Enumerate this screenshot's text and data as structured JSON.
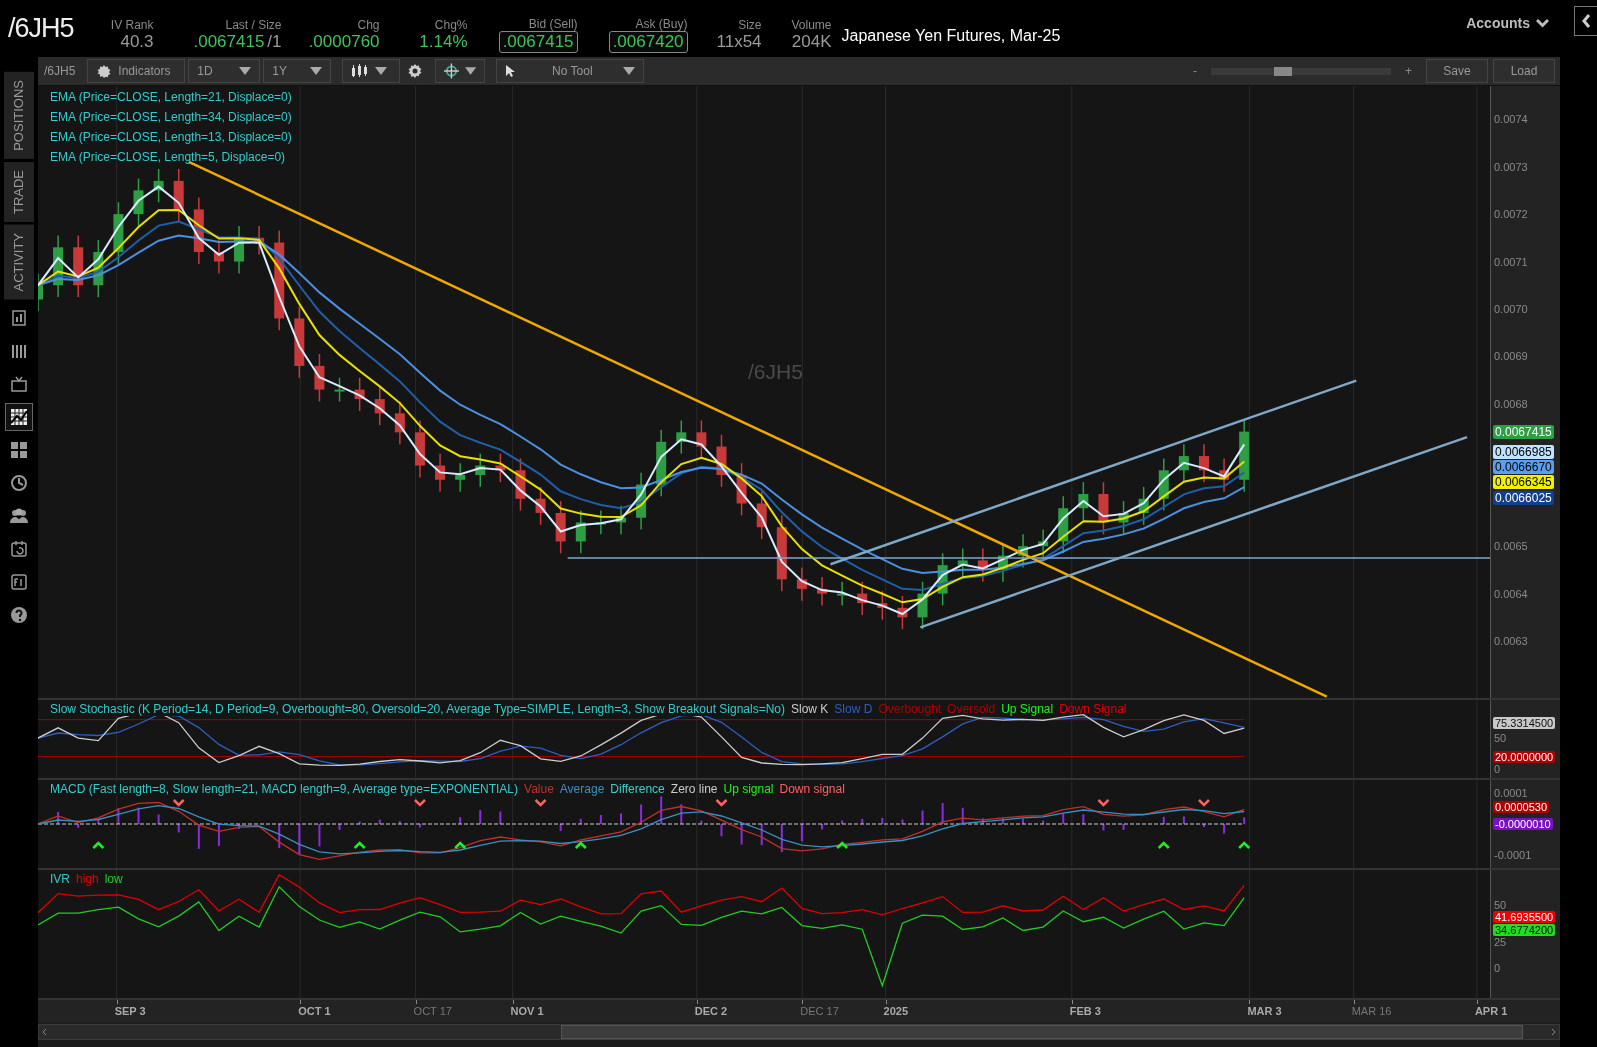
{
  "header": {
    "symbol": "/6JH5",
    "fields": [
      {
        "label": "IV Rank",
        "value": "40.3",
        "color": "#9a9a9a",
        "boxed": false
      },
      {
        "label": "Last / Size",
        "value": ".0067415",
        "extra": "/1",
        "color": "#3cc35a",
        "boxed": false
      },
      {
        "label": "Chg",
        "value": ".0000760",
        "color": "#3cc35a",
        "boxed": false
      },
      {
        "label": "Chg%",
        "value": "1.14%",
        "color": "#3cc35a",
        "boxed": false
      },
      {
        "label": "Bid (Sell)",
        "value": ".0067415",
        "color": "#3cc35a",
        "boxed": true
      },
      {
        "label": "Ask (Buy)",
        "value": ".0067420",
        "color": "#3cc35a",
        "boxed": true
      },
      {
        "label": "Size",
        "value": "11x54",
        "color": "#9a9a9a",
        "boxed": false
      },
      {
        "label": "Volume",
        "value": "204K",
        "color": "#9a9a9a",
        "boxed": false
      }
    ],
    "description": "Japanese Yen Futures, Mar-25",
    "accounts": "Accounts"
  },
  "sidebar": {
    "tabs": [
      {
        "label": "POSITIONS",
        "selected": false
      },
      {
        "label": "TRADE",
        "selected": false
      },
      {
        "label": "ACTIVITY",
        "selected": false
      }
    ],
    "tools": [
      {
        "selected": false
      },
      {
        "selected": false
      },
      {
        "selected": false
      },
      {
        "selected": true
      },
      {
        "selected": false
      },
      {
        "selected": false
      },
      {
        "selected": false
      },
      {
        "selected": false
      },
      {
        "selected": false
      },
      {
        "selected": false
      }
    ]
  },
  "toolbar": {
    "symbol": "/6JH5",
    "indicators": "Indicators",
    "aggregation": "1D",
    "period": "1Y",
    "drawing_tool": "No Tool",
    "zoom_out": "-",
    "zoom_in": "+",
    "zoom": {
      "level": 0.4
    },
    "buttons": [
      "Save",
      "Load"
    ]
  },
  "price_chart": {
    "watermark": "/6JH5",
    "legend": [
      {
        "label": "EMA (Price=CLOSE, Length=21, Displace=0)"
      },
      {
        "label": "EMA (Price=CLOSE, Length=34, Displace=0)"
      },
      {
        "label": "EMA (Price=CLOSE, Length=13, Displace=0)"
      },
      {
        "label": "EMA (Price=CLOSE, Length=5, Displace=0)"
      }
    ],
    "price_tags": [
      {
        "text": "0.0067415",
        "color": "#2e9e44"
      },
      {
        "text": "0.0066985",
        "color": "#bfe3ff"
      },
      {
        "text": "0.0066670",
        "color": "#5a9ef0"
      },
      {
        "text": "0.0066345",
        "color": "#f0f000"
      },
      {
        "text": "0.0066025",
        "color": "#123f8c"
      }
    ],
    "y_axis_labels": [
      "0.0074",
      "0.0073",
      "0.0072",
      "0.0071",
      "0.0070",
      "0.0069",
      "0.0068",
      "0.0065",
      "0.0064",
      "0.0063"
    ]
  },
  "time_axis": {
    "labels": [
      {
        "text": "SEP 3",
        "major": true
      },
      {
        "text": "OCT 1",
        "major": true
      },
      {
        "text": "OCT 17",
        "major": false
      },
      {
        "text": "NOV 1",
        "major": true
      },
      {
        "text": "DEC 2",
        "major": true
      },
      {
        "text": "DEC 17",
        "major": false
      },
      {
        "text": "2025",
        "major": true
      },
      {
        "text": "FEB 3",
        "major": true
      },
      {
        "text": "MAR 3",
        "major": true
      },
      {
        "text": "MAR 16",
        "major": false
      },
      {
        "text": "APR 1",
        "major": true
      }
    ]
  },
  "studies": [
    {
      "kind": "stochastic",
      "title": "Slow Stochastic (K Period=14, D Period=9, Overbought=80, Oversold=20, Average Type=SIMPLE, Length=3, Show Breakout Signals=No)",
      "legend": [
        {
          "label": "Slow K",
          "color": "#cccccc"
        },
        {
          "label": "Slow D",
          "color": "#2b5fc0"
        },
        {
          "label": "Overbought",
          "color": "#b00000"
        },
        {
          "label": "Oversold",
          "color": "#b00000"
        },
        {
          "label": "Up Signal",
          "color": "#22ee22"
        },
        {
          "label": "Down Signal",
          "color": "#e00000"
        }
      ],
      "axis_labels": [
        {
          "text": "50"
        },
        {
          "text": "0"
        }
      ],
      "tags": [
        {
          "text": "75.3314500",
          "color": "#c8c8c8"
        },
        {
          "text": "20.0000000",
          "color": "#b00000"
        }
      ]
    },
    {
      "kind": "macd",
      "title": "MACD (Fast length=8, Slow length=21, MACD length=9, Average type=EXPONENTIAL)",
      "legend": [
        {
          "label": "Value",
          "color": "#c0302b"
        },
        {
          "label": "Average",
          "color": "#3a8fc0"
        },
        {
          "label": "Difference",
          "color": "#44cccc"
        },
        {
          "label": "Zero line",
          "color": "#cccccc"
        },
        {
          "label": "Up signal",
          "color": "#22ee22"
        },
        {
          "label": "Down signal",
          "color": "#ff6060"
        }
      ],
      "axis_labels": [
        {
          "text": "0.0001"
        },
        {
          "text": "-0.0001"
        }
      ],
      "tags": [
        {
          "text": "0.0000530",
          "color": "#b00000"
        },
        {
          "text": "-0.0000010",
          "color": "#7a10c0"
        }
      ]
    },
    {
      "kind": "ivr",
      "title": "IVR",
      "legend": [
        {
          "label": "high",
          "color": "#e00000"
        },
        {
          "label": "low",
          "color": "#22cc22"
        }
      ],
      "axis_labels": [
        {
          "text": "50"
        },
        {
          "text": "25"
        },
        {
          "text": "0"
        }
      ],
      "tags": [
        {
          "text": "41.6935500",
          "color": "#ee0000"
        },
        {
          "text": "34.6774200",
          "color": "#22dd22"
        }
      ]
    }
  ]
}
